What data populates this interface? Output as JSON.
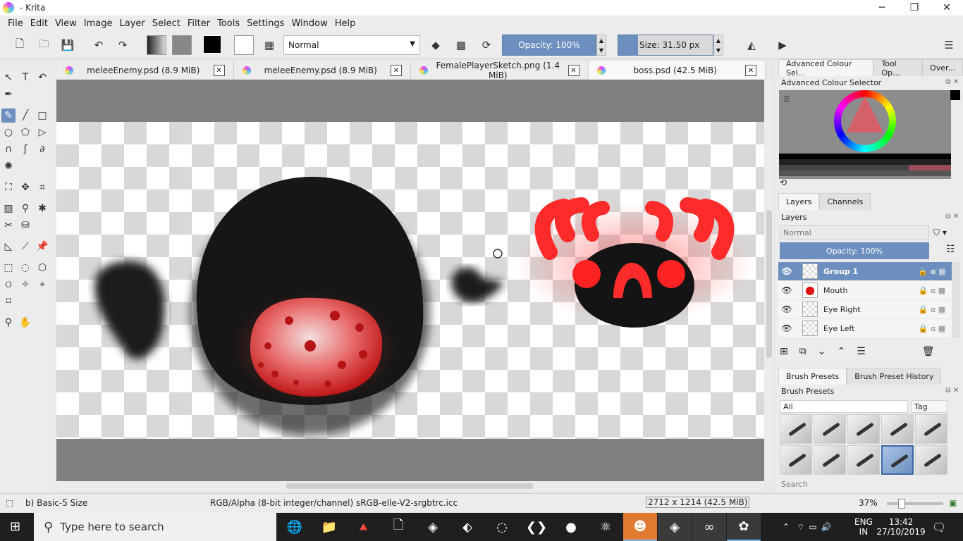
{
  "window": {
    "title": "- Krita",
    "minimize": "─",
    "restore": "❐",
    "close": "✕"
  },
  "menu": [
    "File",
    "Edit",
    "View",
    "Image",
    "Layer",
    "Select",
    "Filter",
    "Tools",
    "Settings",
    "Window",
    "Help"
  ],
  "toolbar": {
    "blend_mode": "Normal",
    "opacity": "Opacity: 100%",
    "size": "Size: 31.50 px"
  },
  "tabs": [
    {
      "name": "meleeEnemy.psd",
      "size": "(8.9 MiB)",
      "active": false
    },
    {
      "name": "meleeEnemy.psd",
      "size": "(8.9 MiB)",
      "active": false
    },
    {
      "name": "FemalePlayerSketch.png",
      "size": "(1.4 MiB)",
      "active": false
    },
    {
      "name": "boss.psd",
      "size": "(42.5 MiB)",
      "active": true
    }
  ],
  "dock": {
    "top_tabs": [
      "Advanced Colour Sel...",
      "Tool Op...",
      "Over..."
    ],
    "color_title": "Advanced Colour Selector",
    "layer_tabs": [
      "Layers",
      "Channels"
    ],
    "layers_title": "Layers",
    "layer_blend": "Normal",
    "layer_opacity": "Opacity:  100%",
    "layers": [
      {
        "name": "Group 1",
        "selected": true
      },
      {
        "name": "Mouth",
        "selected": false
      },
      {
        "name": "Eye Right",
        "selected": false
      },
      {
        "name": "Eye Left",
        "selected": false
      }
    ],
    "brush_tabs": [
      "Brush Presets",
      "Brush Preset History"
    ],
    "brush_title": "Brush Presets",
    "brush_filter": "All",
    "brush_tag": "Tag",
    "brush_search": "Search"
  },
  "status": {
    "brush": "b) Basic-5 Size",
    "color_space": "RGB/Alpha (8-bit integer/channel)  sRGB-elle-V2-srgbtrc.icc",
    "dimensions": "2712 x 1214 (42.5 MiB)",
    "zoom": "37%"
  },
  "taskbar": {
    "search_placeholder": "Type here to search",
    "lang_top": "ENG",
    "lang_bottom": "IN",
    "time": "13:42",
    "date": "27/10/2019"
  },
  "colors": {
    "accent": "#6c8fbf",
    "boss_red": "#ff2a2a",
    "canvas_bg": "#7f7f7f"
  }
}
